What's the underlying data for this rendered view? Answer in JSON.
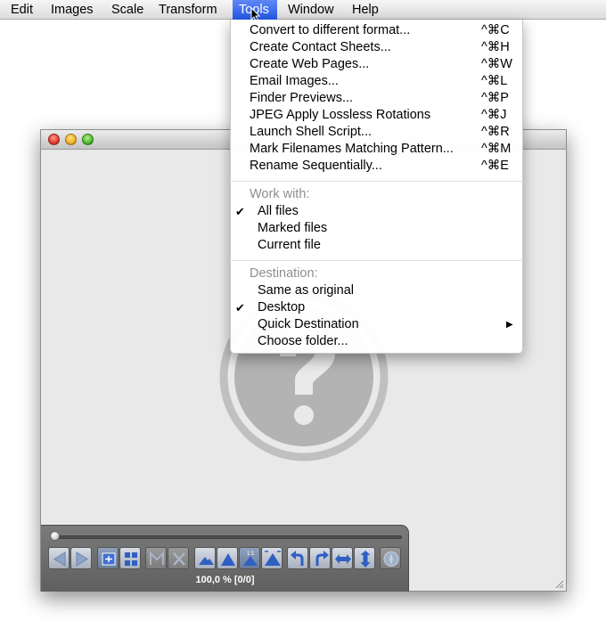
{
  "menubar": {
    "items": [
      "Edit",
      "Images",
      "Scale",
      "Transform",
      "Tools",
      "Window",
      "Help"
    ],
    "active": "Tools"
  },
  "tools_menu": {
    "items": [
      {
        "label": "Convert to different format...",
        "shortcut": "^⌘C"
      },
      {
        "label": "Create Contact Sheets...",
        "shortcut": "^⌘H"
      },
      {
        "label": "Create Web Pages...",
        "shortcut": "^⌘W"
      },
      {
        "label": "Email Images...",
        "shortcut": "^⌘L"
      },
      {
        "label": "Finder Previews...",
        "shortcut": "^⌘P"
      },
      {
        "label": "JPEG Apply Lossless Rotations",
        "shortcut": "^⌘J"
      },
      {
        "label": "Launch Shell Script...",
        "shortcut": "^⌘R"
      },
      {
        "label": "Mark Filenames Matching Pattern...",
        "shortcut": "^⌘M"
      },
      {
        "label": "Rename Sequentially...",
        "shortcut": "^⌘E"
      }
    ],
    "work_with": {
      "header": "Work with:",
      "options": [
        {
          "label": "All files",
          "checked": true
        },
        {
          "label": "Marked files",
          "checked": false
        },
        {
          "label": "Current file",
          "checked": false
        }
      ]
    },
    "destination": {
      "header": "Destination:",
      "options": [
        {
          "label": "Same as original",
          "checked": false
        },
        {
          "label": "Desktop",
          "checked": true
        },
        {
          "label": "Quick Destination",
          "checked": false,
          "submenu": true
        },
        {
          "label": "Choose folder...",
          "checked": false
        }
      ]
    },
    "check_mark": "✔",
    "submenu_arrow": "▶"
  },
  "window": {
    "status": "100,0 %  [0/0]",
    "slider_value": 0,
    "placeholder_icon": "question-mark-icon"
  },
  "colors": {
    "menu_highlight": "#2e63ea",
    "window_bg": "#e9e9e9",
    "hud_bg": "#6e6e6e",
    "placeholder": "#c0c0c0"
  }
}
